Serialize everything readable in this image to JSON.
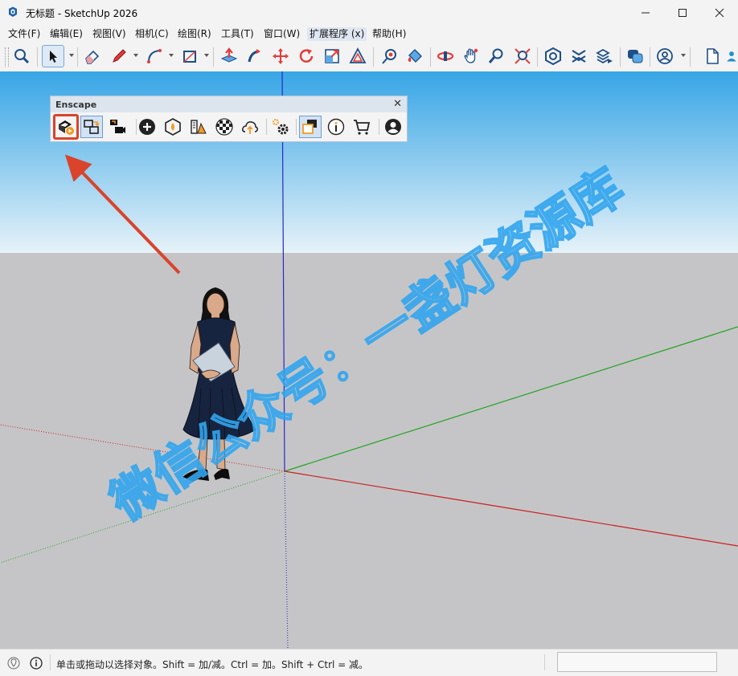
{
  "window": {
    "title": "无标题 - SketchUp 2026",
    "app_icon": "sketchup-logo-icon",
    "controls": [
      "minimize-icon",
      "maximize-icon",
      "close-icon"
    ]
  },
  "menu": {
    "items": [
      {
        "label": "文件(F)"
      },
      {
        "label": "编辑(E)"
      },
      {
        "label": "视图(V)"
      },
      {
        "label": "相机(C)"
      },
      {
        "label": "绘图(R)"
      },
      {
        "label": "工具(T)"
      },
      {
        "label": "窗口(W)"
      },
      {
        "label": "扩展程序 (x)",
        "active": true
      },
      {
        "label": "帮助(H)"
      }
    ]
  },
  "toolbar": {
    "icons": [
      "zoom-icon",
      "select-icon",
      "eraser-icon",
      "pencil-icon",
      "arc-icon",
      "rectangle-icon",
      "push-pull-icon",
      "follow-me-icon",
      "move-icon",
      "rotate-icon",
      "scale-icon",
      "offset-icon",
      "tape-measure-icon",
      "paint-bucket-icon",
      "orbit-icon",
      "pan-icon",
      "zoom-view-icon",
      "zoom-extents-icon",
      "warehouse-icon",
      "extension-warehouse-icon",
      "layout-icon",
      "components-icon",
      "account-icon",
      "new-file-icon",
      "user-icon"
    ]
  },
  "enscape": {
    "title": "Enscape",
    "buttons": [
      "enscape-start-icon",
      "live-update-icon",
      "video-editor-icon",
      "add-asset-icon",
      "materials-icon",
      "scene-manager-icon",
      "checker-icon",
      "upload-icon",
      "settings-icon",
      "view-sync-icon",
      "info-icon",
      "cart-icon",
      "account-icon"
    ],
    "highlight_color": "#d9442b"
  },
  "scene": {
    "sky_top": "#37a5e6",
    "sky_bottom": "#e6f2f8",
    "ground": "#c5c5c7",
    "axis_red": "#cc1f1f",
    "axis_green": "#21a421",
    "axis_blue": "#2828c8",
    "arrow_color": "#d9442b",
    "watermark": "微信公众号：一盏灯资源库"
  },
  "status": {
    "text": "单击或拖动以选择对象。Shift = 加/减。Ctrl = 加。Shift + Ctrl = 减。",
    "icons": [
      "geo-location-icon",
      "info-icon"
    ]
  }
}
